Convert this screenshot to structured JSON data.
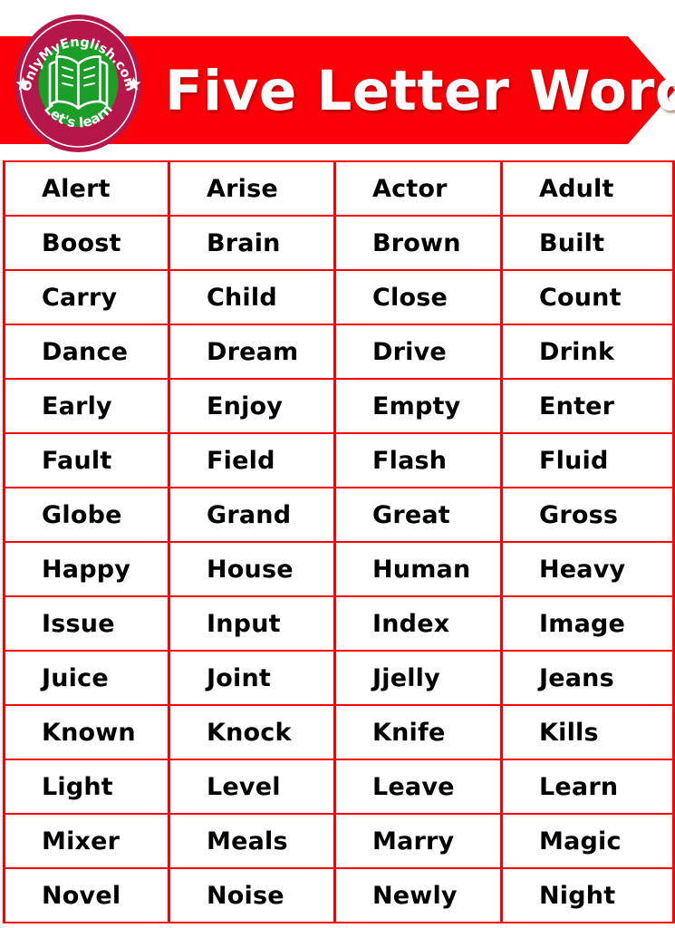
{
  "header": {
    "title": "Five Letter Words",
    "banner_color": "#FB0007",
    "title_color": "#FFFFFF",
    "logo": {
      "top_text": "OnlyMyEnglish.com",
      "bottom_text": "Let's learn",
      "icon": "open-book-icon",
      "ring_color": "#B5174B",
      "inner_circle_color": "#1A9E28",
      "star_count": 2
    }
  },
  "table": {
    "columns": 4,
    "rows": 14,
    "border_color": "#FD0000",
    "text_color": "#000000",
    "background_color": "#FFFFFF",
    "data": [
      [
        "Alert",
        "Arise",
        "Actor",
        "Adult"
      ],
      [
        "Boost",
        "Brain",
        "Brown",
        "Built"
      ],
      [
        "Carry",
        "Child",
        "Close",
        "Count"
      ],
      [
        "Dance",
        "Dream",
        "Drive",
        "Drink"
      ],
      [
        "Early",
        "Enjoy",
        "Empty",
        "Enter"
      ],
      [
        "Fault",
        "Field",
        "Flash",
        "Fluid"
      ],
      [
        "Globe",
        "Grand",
        "Great",
        "Gross"
      ],
      [
        "Happy",
        "House",
        "Human",
        "Heavy"
      ],
      [
        "Issue",
        "Input",
        "Index",
        "Image"
      ],
      [
        "Juice",
        "Joint",
        "Jjelly",
        "Jeans"
      ],
      [
        "Known",
        "Knock",
        "Knife",
        "Kills"
      ],
      [
        "Light",
        "Level",
        "Leave",
        "Learn"
      ],
      [
        "Mixer",
        "Meals",
        "Marry",
        "Magic"
      ],
      [
        "Novel",
        "Noise",
        "Newly",
        "Night"
      ]
    ]
  }
}
